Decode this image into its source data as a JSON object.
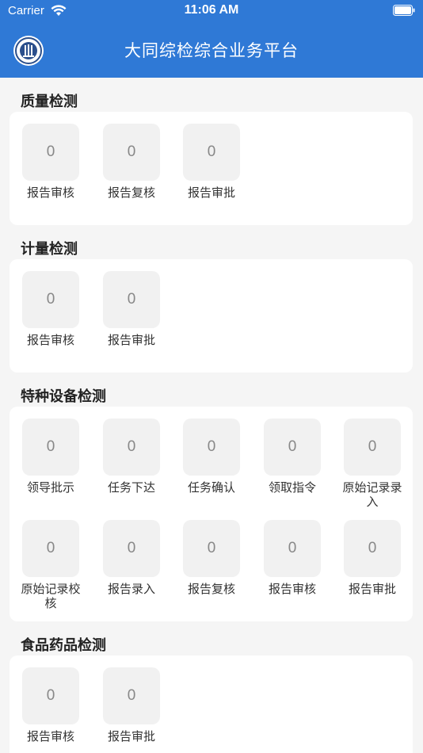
{
  "status_bar": {
    "carrier": "Carrier",
    "time": "11:06 AM"
  },
  "nav": {
    "title": "大同综检综合业务平台",
    "logo_icon": "emblem-logo-icon"
  },
  "colors": {
    "header": "#2f79d6",
    "card": "#ffffff",
    "box": "#f1f1f1"
  },
  "sections": [
    {
      "title": "质量检测",
      "items": [
        {
          "count": "0",
          "label": "报告审核"
        },
        {
          "count": "0",
          "label": "报告复核"
        },
        {
          "count": "0",
          "label": "报告审批"
        }
      ]
    },
    {
      "title": "计量检测",
      "items": [
        {
          "count": "0",
          "label": "报告审核"
        },
        {
          "count": "0",
          "label": "报告审批"
        }
      ]
    },
    {
      "title": "特种设备检测",
      "items": [
        {
          "count": "0",
          "label": "领导批示"
        },
        {
          "count": "0",
          "label": "任务下达"
        },
        {
          "count": "0",
          "label": "任务确认"
        },
        {
          "count": "0",
          "label": "领取指令"
        },
        {
          "count": "0",
          "label": "原始记录录入"
        },
        {
          "count": "0",
          "label": "原始记录校核"
        },
        {
          "count": "0",
          "label": "报告录入"
        },
        {
          "count": "0",
          "label": "报告复核"
        },
        {
          "count": "0",
          "label": "报告审核"
        },
        {
          "count": "0",
          "label": "报告审批"
        }
      ]
    },
    {
      "title": "食品药品检测",
      "items": [
        {
          "count": "0",
          "label": "报告审核"
        },
        {
          "count": "0",
          "label": "报告审批"
        }
      ]
    }
  ]
}
